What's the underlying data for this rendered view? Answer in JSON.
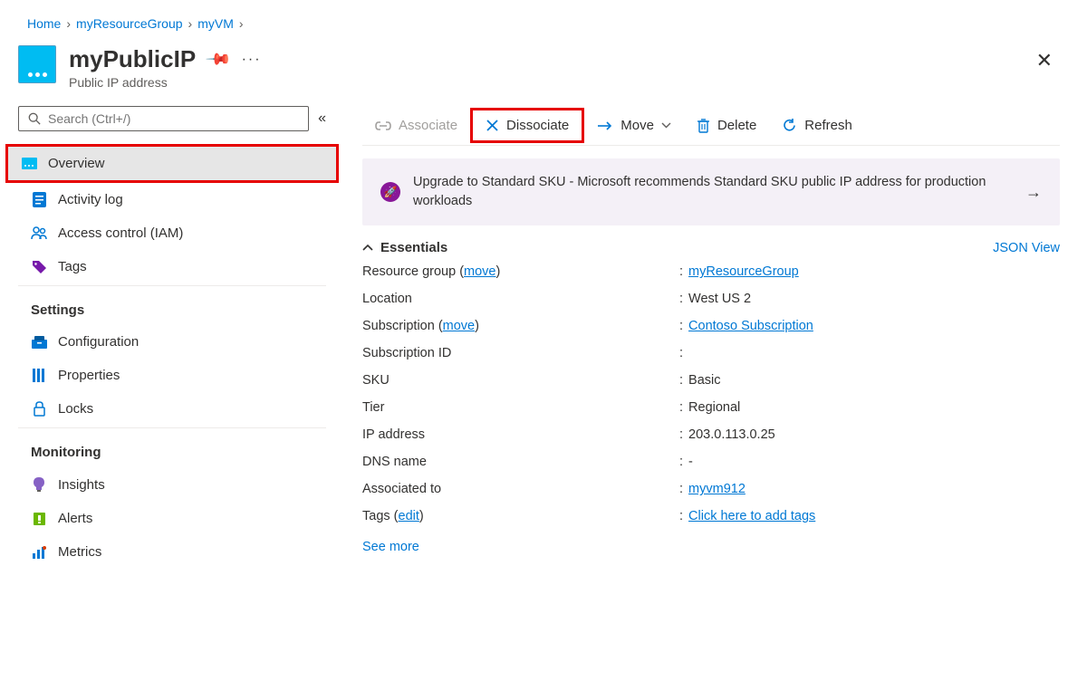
{
  "breadcrumb": [
    {
      "label": "Home"
    },
    {
      "label": "myResourceGroup"
    },
    {
      "label": "myVM"
    }
  ],
  "header": {
    "title": "myPublicIP",
    "subtitle": "Public IP address"
  },
  "sidebar": {
    "search_placeholder": "Search (Ctrl+/)",
    "main_items": [
      {
        "label": "Overview"
      },
      {
        "label": "Activity log"
      },
      {
        "label": "Access control (IAM)"
      },
      {
        "label": "Tags"
      }
    ],
    "settings_label": "Settings",
    "settings_items": [
      {
        "label": "Configuration"
      },
      {
        "label": "Properties"
      },
      {
        "label": "Locks"
      }
    ],
    "monitoring_label": "Monitoring",
    "monitoring_items": [
      {
        "label": "Insights"
      },
      {
        "label": "Alerts"
      },
      {
        "label": "Metrics"
      }
    ]
  },
  "toolbar": {
    "associate": "Associate",
    "dissociate": "Dissociate",
    "move": "Move",
    "delete": "Delete",
    "refresh": "Refresh"
  },
  "banner": {
    "text": "Upgrade to Standard SKU - Microsoft recommends Standard SKU public IP address for production workloads"
  },
  "essentials": {
    "title": "Essentials",
    "json_link": "JSON View",
    "rows": {
      "resource_group_label": "Resource group",
      "resource_group_move": "move",
      "resource_group_value": "myResourceGroup",
      "location_label": "Location",
      "location_value": "West US 2",
      "subscription_label": "Subscription",
      "subscription_move": "move",
      "subscription_value": "Contoso Subscription",
      "subscription_id_label": "Subscription ID",
      "subscription_id_value": "",
      "sku_label": "SKU",
      "sku_value": "Basic",
      "tier_label": "Tier",
      "tier_value": "Regional",
      "ip_label": "IP address",
      "ip_value": "203.0.113.0.25",
      "dns_label": "DNS name",
      "dns_value": "-",
      "assoc_label": "Associated to",
      "assoc_value": "myvm912",
      "tags_label": "Tags",
      "tags_edit": "edit",
      "tags_value": "Click here to add tags"
    },
    "see_more": "See more"
  }
}
